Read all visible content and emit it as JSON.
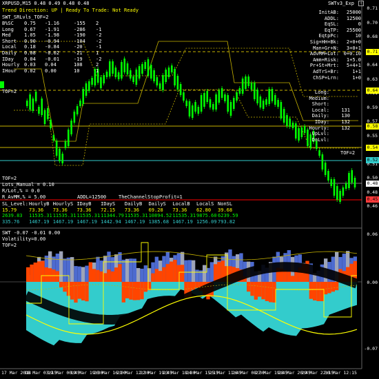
{
  "window": {
    "symbol_line": "XRPUSD,M15  0.48 0.49 0.48 0.48",
    "status_line": "Trend Direction:  UP  |  Ready To Trade:  Not Ready",
    "indicator_name": "SWT_SRLvls_TOF=2",
    "expert_name": "SWTv3_Exp"
  },
  "left_stats": {
    "rows": [
      [
        "B%SC",
        "0.75",
        "-1.16",
        "-155",
        "2"
      ],
      [
        "Long",
        "0.67",
        "-1.91",
        "-286",
        "-1"
      ],
      [
        "Med",
        "1.05",
        "-1.98",
        "-190",
        "-2"
      ],
      [
        "Short",
        "0.90",
        "-0.94",
        "-104",
        "-2"
      ],
      [
        "Local",
        "0.18",
        "-0.84",
        "-20",
        "-1"
      ],
      [
        "Daily",
        "0.08",
        "-0.02",
        "-21",
        "1"
      ],
      [
        "IDay",
        "0.04",
        "-0.01",
        "-19",
        "-2"
      ],
      [
        "Hourly",
        "0.03",
        "0.04",
        "108",
        "2"
      ],
      [
        "IHour",
        "0.02",
        "0.00",
        "10",
        "1"
      ]
    ],
    "tof": "TOF=2"
  },
  "right_panel": {
    "rows": [
      [
        "InitAB:",
        "25000"
      ],
      [
        "ADDL:",
        "12500"
      ],
      [
        "EqSL:",
        "0"
      ],
      [
        "EqTP:",
        "25500"
      ],
      [
        "EqtpPc:",
        "10"
      ],
      [
        "Sig+HH+Bk:",
        "2+0+0"
      ],
      [
        "Man+Gr+N:",
        "3+0+1"
      ],
      [
        "AdvMM+Lot:",
        "0+0.10"
      ],
      [
        "Amm+Risk:",
        "1+5.0"
      ],
      [
        "Pr+St+Mrt:",
        "5+4+1"
      ],
      [
        "AdTrS+Br:",
        "1+1"
      ],
      [
        "ChSP+Lrn:",
        "1+0"
      ]
    ],
    "levels": [
      "Long",
      "Medium",
      "Short",
      "Local",
      "Daily",
      "IDay",
      "Hourly",
      "UpLvl",
      "DnLvl"
    ],
    "level_values": [
      "",
      "",
      "",
      "131",
      "130",
      "132",
      "132",
      "",
      ""
    ],
    "tof2": "TOF=2"
  },
  "bottom_info": {
    "tof": "TOF=2",
    "lots": "Lots_Manual = 0.10",
    "rlot": "R/Lot,% = 0.0",
    "addl": "ADDL=12500",
    "rammm": "R_AvMM,% = 5.00",
    "channel": "TheChannelStopProfit=1"
  },
  "sl_table": {
    "header": [
      "SL_Level:",
      "HourlyB",
      "HourlyS",
      "IDayB",
      "IDayS",
      "DailyB",
      "DailyS",
      "LocalB",
      "LocalS",
      "NonSL"
    ],
    "row1": [
      "15.79",
      "73.36",
      "73.36",
      "73.36",
      "72.15",
      "73.36",
      "69.28",
      "73.36",
      "62.80",
      "39.68"
    ],
    "row2": [
      "2639.83",
      "11535.31",
      "11535.31",
      "11535.31",
      "11344.79",
      "11535.31",
      "10894.52",
      "11535.31",
      "9875.60",
      "6239.59"
    ],
    "row3": [
      "335.76",
      "1467.19",
      "1467.19",
      "1467.19",
      "1442.94",
      "1467.19",
      "1385.68",
      "1467.19",
      "1256.09",
      "793.82"
    ]
  },
  "subwindow": {
    "title": "SWT -0.07 -0.01 0.00",
    "volatility": "Volatility=0.00",
    "tof": "TOF=2"
  },
  "price_axis": {
    "ticks": [
      "0.71",
      "0.70",
      "0.68",
      "0.66",
      "0.64",
      "0.63",
      "0.61",
      "0.59",
      "0.57",
      "0.55",
      "0.53",
      "0.51",
      "0.50",
      "0.48",
      "0.46"
    ],
    "tags": [
      "0.71",
      "0.64",
      "0.58",
      "0.54",
      "0.52",
      "0.48",
      "0.45"
    ]
  },
  "sub_axis": {
    "ticks": [
      "0.06",
      "0.00",
      "-0.07"
    ]
  },
  "time_axis": {
    "labels": [
      "17 Mar 2018",
      "18 Mar 03:15",
      "19 Mar 00:45",
      "19 Mar 19:30",
      "20 Mar 16:00",
      "21 Mar 12:30",
      "22 Mar 19:45",
      "23 Mar 18:30",
      "24 Mar 15:15",
      "25 Mar 11:45",
      "26 Mar 08:30",
      "27 Mar 19:45",
      "28 Mar 20:45",
      "29 Mar 22:15",
      "30 Mar 12:15"
    ]
  },
  "colors": {
    "bg": "#000000",
    "candle": "#00ff00",
    "level": "#c8b400",
    "price_tag": "#ffff00",
    "cyan": "#33cccc",
    "orange": "#ff4500",
    "blue_hist": "#4d6bd0",
    "grey_hist": "#9ea4b8"
  }
}
